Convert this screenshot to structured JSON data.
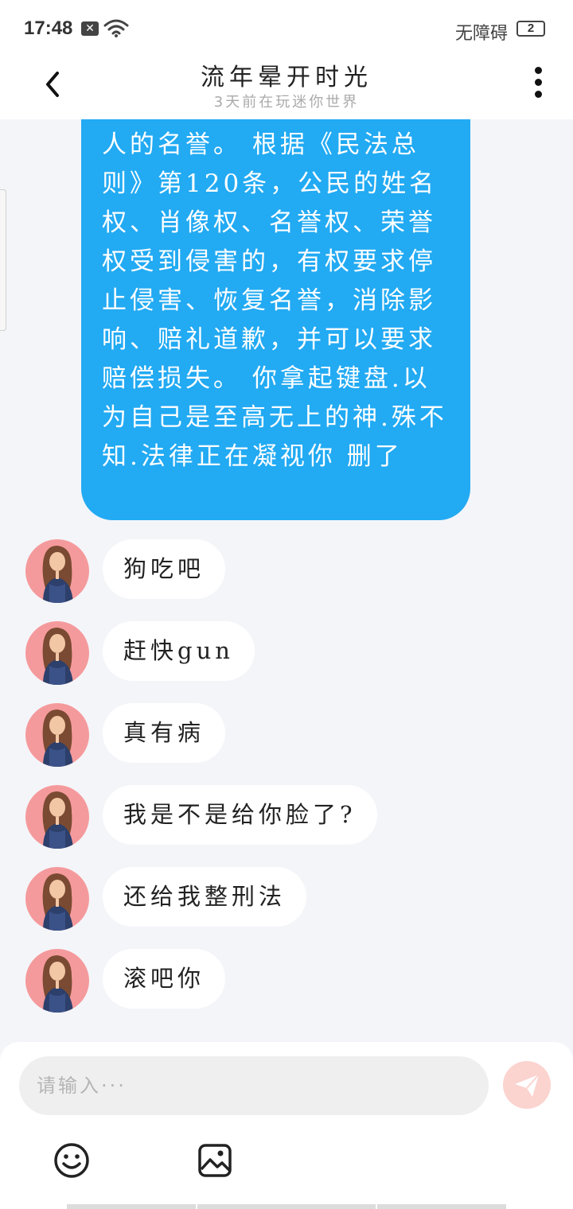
{
  "status_bar": {
    "time": "17:48",
    "notification_icon": "x-box-icon",
    "wifi_icon": "wifi-icon",
    "accessibility_label": "无障碍",
    "battery_badge": "2"
  },
  "header": {
    "title": "流年晕开时光",
    "subtitle": "3天前在玩迷你世界",
    "back_icon": "back-arrow-icon",
    "more_icon": "more-vertical-icon"
  },
  "chat": {
    "sent_message": "人的名誉。 根据《民法总则》第120条，公民的姓名权、肖像权、名誉权、荣誉权受到侵害的，有权要求停止侵害、恢复名誉，消除影响、赔礼道歉，并可以要求赔偿损失。 你拿起键盘.以为自己是至高无上的神.殊不知.法律正在凝视你 删了",
    "received_messages": [
      {
        "text": "狗吃吧"
      },
      {
        "text": "赶快gun"
      },
      {
        "text": "真有病"
      },
      {
        "text": "我是不是给你脸了?"
      },
      {
        "text": "还给我整刑法"
      },
      {
        "text": "滚吧你"
      }
    ]
  },
  "composer": {
    "placeholder": "请输入···",
    "send_icon": "paper-plane-icon",
    "emoji_icon": "smiley-icon",
    "image_icon": "image-icon"
  },
  "colors": {
    "sent_bubble": "#22aaf3",
    "avatar_bg": "#f59a9c",
    "send_button_bg": "#fbd3cf",
    "background": "#f4f5f9"
  }
}
